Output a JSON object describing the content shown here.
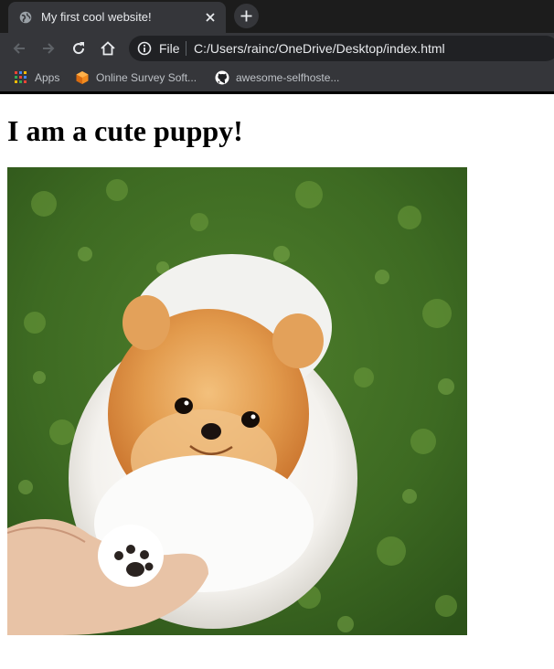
{
  "browser": {
    "tab": {
      "title": "My first cool website!",
      "favicon": "globe-icon",
      "close": "close-icon"
    },
    "new_tab": "plus-icon",
    "nav": {
      "back": "back-arrow-icon",
      "forward": "forward-arrow-icon",
      "reload": "reload-icon",
      "home": "home-icon"
    },
    "omnibox": {
      "scheme": "File",
      "url": "C:/Users/rainc/OneDrive/Desktop/index.html",
      "icon": "info-icon"
    },
    "bookmarks": [
      {
        "label": "Apps",
        "icon": "apps-grid-icon"
      },
      {
        "label": "Online Survey Soft...",
        "icon": "orange-cube-icon"
      },
      {
        "label": "awesome-selfhoste...",
        "icon": "github-icon"
      }
    ]
  },
  "page": {
    "heading": "I am a cute puppy!",
    "image": "pomeranian-puppy-photo"
  },
  "colors": {
    "chrome_dark": "#000000",
    "tab_bg": "#35363a",
    "omnibox_bg": "#202124",
    "text_light": "#e8eaed",
    "grass": "#3f6b24",
    "fur_orange": "#d9843a"
  }
}
